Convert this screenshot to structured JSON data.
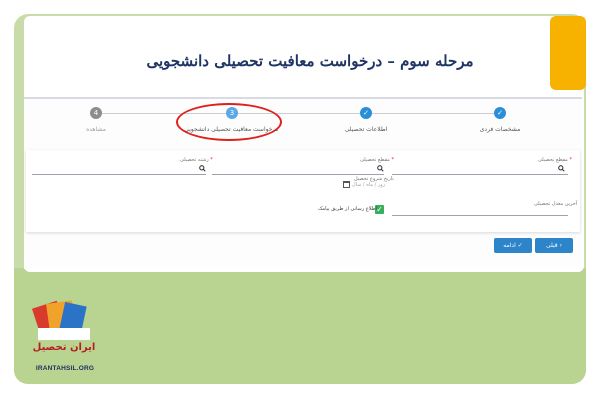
{
  "page": {
    "title": "مرحله سوم – درخواست معافیت تحصیلی دانشجویی",
    "logo_name": "ایران تحصیل",
    "logo_url": "IRANTAHSIL.ORG"
  },
  "stepper": {
    "steps": [
      {
        "label": "مشخصات فردی",
        "marker": "✓",
        "state": "done"
      },
      {
        "label": "اطلاعات تحصیلی",
        "marker": "✓",
        "state": "done"
      },
      {
        "label": "درخواست معافیت تحصیلی دانشجویی",
        "marker": "3",
        "state": "active"
      },
      {
        "label": "مشاهده",
        "marker": "4",
        "state": "pending"
      }
    ]
  },
  "form": {
    "field_level": "مقطع تحصیلی",
    "field_grade": "مقطع تحصیلی",
    "field_major": "رشته تحصیلی",
    "required_mark": "*",
    "start_date_label": "تاریخ شروع تحصیل",
    "start_date_placeholder": "روز / ماه / سال",
    "average_label": "آخرین معدل تحصیلی",
    "sms_checkbox_label": "اطلاع رسانی از طریق پیامک",
    "sms_checked": true
  },
  "buttons": {
    "prev_label": "قبلی",
    "next_label": "ادامه"
  },
  "colors": {
    "title": "#1f3566",
    "primary": "#2d84c9",
    "highlight_ring": "#e0201c",
    "accent_tab": "#f7b200",
    "panel_green": "#c8dcaa"
  }
}
